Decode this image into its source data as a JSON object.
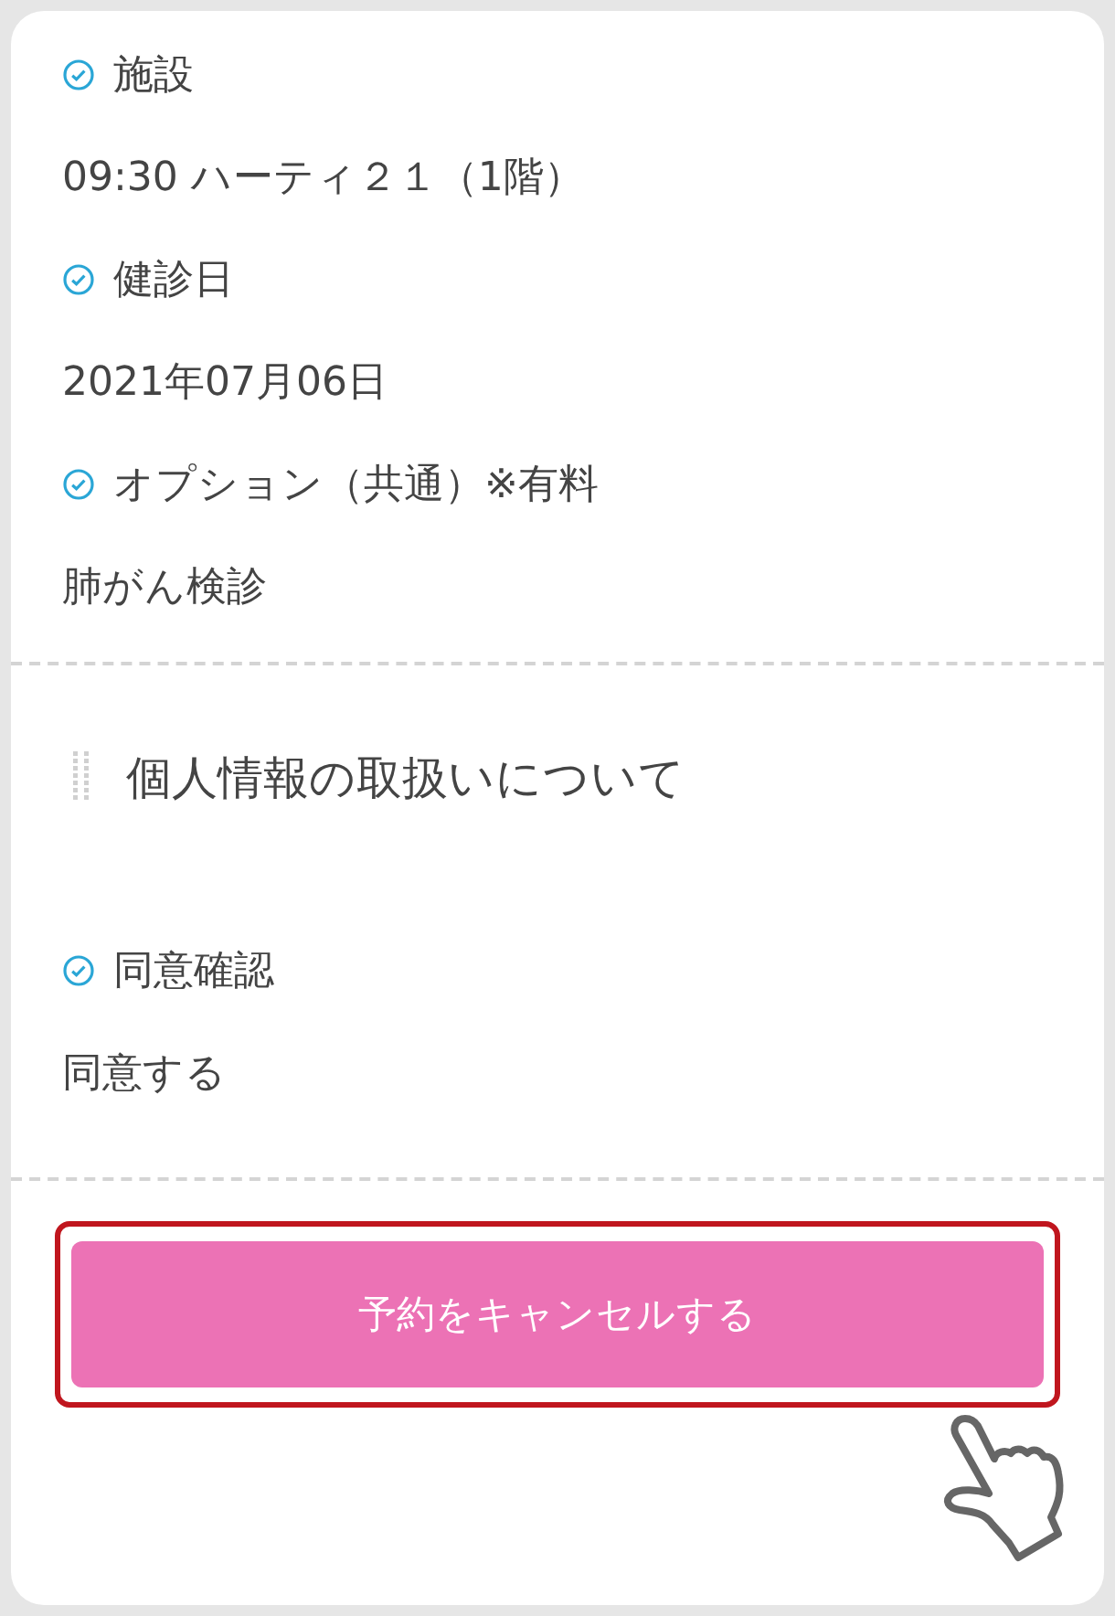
{
  "details": [
    {
      "label": "施設",
      "value": "09:30 ハーティ２１（1階）"
    },
    {
      "label": "健診日",
      "value": "2021年07月06日"
    },
    {
      "label": "オプション（共通）※有料",
      "value": "肺がん検診"
    }
  ],
  "privacy": {
    "title": "個人情報の取扱いについて",
    "fields": [
      {
        "label": "同意確認",
        "value": "同意する"
      }
    ]
  },
  "cancel_button": {
    "label": "予約をキャンセルする",
    "highlighted": true
  }
}
